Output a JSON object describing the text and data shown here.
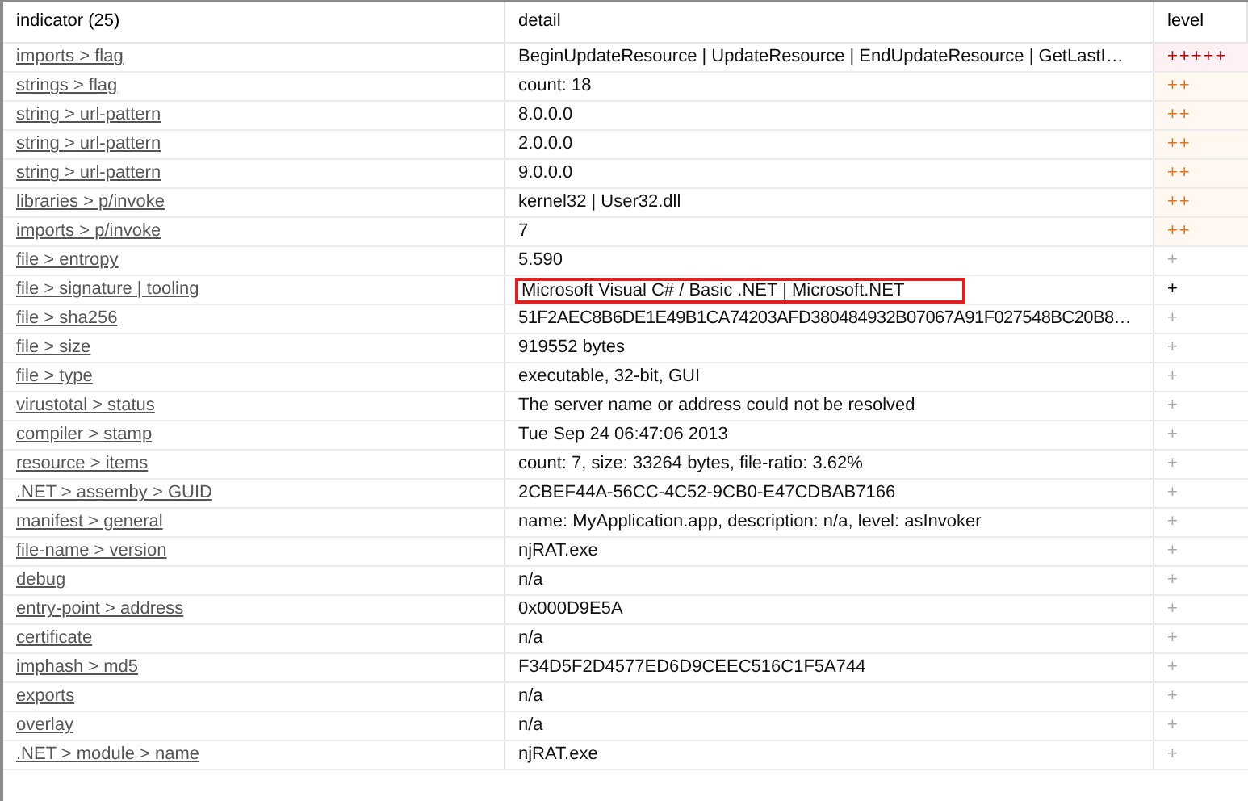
{
  "table": {
    "columns": [
      "indicator (25)",
      "detail",
      "level"
    ],
    "rows": [
      {
        "indicator": "imports > flag",
        "detail": "BeginUpdateResource | UpdateResource | EndUpdateResource | GetLastI…",
        "level": "+++++",
        "kind": "high",
        "highlighted": false
      },
      {
        "indicator": "strings > flag",
        "detail": "count: 18",
        "level": "++",
        "kind": "medium",
        "highlighted": false
      },
      {
        "indicator": "string > url-pattern",
        "detail": "8.0.0.0",
        "level": "++",
        "kind": "medium",
        "highlighted": false
      },
      {
        "indicator": "string > url-pattern",
        "detail": "2.0.0.0",
        "level": "++",
        "kind": "medium",
        "highlighted": false
      },
      {
        "indicator": "string > url-pattern",
        "detail": "9.0.0.0",
        "level": "++",
        "kind": "medium",
        "highlighted": false
      },
      {
        "indicator": "libraries > p/invoke",
        "detail": "kernel32 | User32.dll",
        "level": "++",
        "kind": "medium",
        "highlighted": false
      },
      {
        "indicator": "imports > p/invoke",
        "detail": "7",
        "level": "++",
        "kind": "medium",
        "highlighted": false
      },
      {
        "indicator": "file > entropy",
        "detail": "5.590",
        "level": "+",
        "kind": "low",
        "highlighted": false
      },
      {
        "indicator": "file > signature | tooling",
        "detail": "Microsoft Visual C# / Basic .NET | Microsoft.NET",
        "level": "+",
        "kind": "info",
        "highlighted": true
      },
      {
        "indicator": "file > sha256",
        "detail": "51F2AEC8B6DE1E49B1CA74203AFD380484932B07067A91F027548BC20B8…",
        "level": "+",
        "kind": "low",
        "highlighted": false
      },
      {
        "indicator": "file > size",
        "detail": "919552 bytes",
        "level": "+",
        "kind": "low",
        "highlighted": false
      },
      {
        "indicator": "file > type",
        "detail": "executable, 32-bit, GUI",
        "level": "+",
        "kind": "low",
        "highlighted": false
      },
      {
        "indicator": "virustotal > status",
        "detail": "The server name or address could not be resolved",
        "level": "+",
        "kind": "low",
        "highlighted": false
      },
      {
        "indicator": "compiler > stamp",
        "detail": "Tue Sep 24 06:47:06 2013",
        "level": "+",
        "kind": "low",
        "highlighted": false
      },
      {
        "indicator": "resource > items",
        "detail": "count: 7, size: 33264 bytes, file-ratio: 3.62%",
        "level": "+",
        "kind": "low",
        "highlighted": false
      },
      {
        "indicator": ".NET > assemby > GUID",
        "detail": "2CBEF44A-56CC-4C52-9CB0-E47CDBAB7166",
        "level": "+",
        "kind": "low",
        "highlighted": false
      },
      {
        "indicator": "manifest > general",
        "detail": "name: MyApplication.app, description: n/a, level: asInvoker",
        "level": "+",
        "kind": "low",
        "highlighted": false
      },
      {
        "indicator": "file-name > version",
        "detail": "njRAT.exe",
        "level": "+",
        "kind": "low",
        "highlighted": false
      },
      {
        "indicator": "debug",
        "detail": "n/a",
        "level": "+",
        "kind": "low",
        "highlighted": false
      },
      {
        "indicator": "entry-point > address",
        "detail": "0x000D9E5A",
        "level": "+",
        "kind": "low",
        "highlighted": false
      },
      {
        "indicator": "certificate",
        "detail": "n/a",
        "level": "+",
        "kind": "low",
        "highlighted": false
      },
      {
        "indicator": "imphash > md5",
        "detail": "F34D5F2D4577ED6D9CEEC516C1F5A744",
        "level": "+",
        "kind": "low",
        "highlighted": false
      },
      {
        "indicator": "exports",
        "detail": "n/a",
        "level": "+",
        "kind": "low",
        "highlighted": false
      },
      {
        "indicator": "overlay",
        "detail": "n/a",
        "level": "+",
        "kind": "low",
        "highlighted": false
      },
      {
        "indicator": ".NET > module > name",
        "detail": "njRAT.exe",
        "level": "+",
        "kind": "low",
        "highlighted": false
      }
    ]
  }
}
